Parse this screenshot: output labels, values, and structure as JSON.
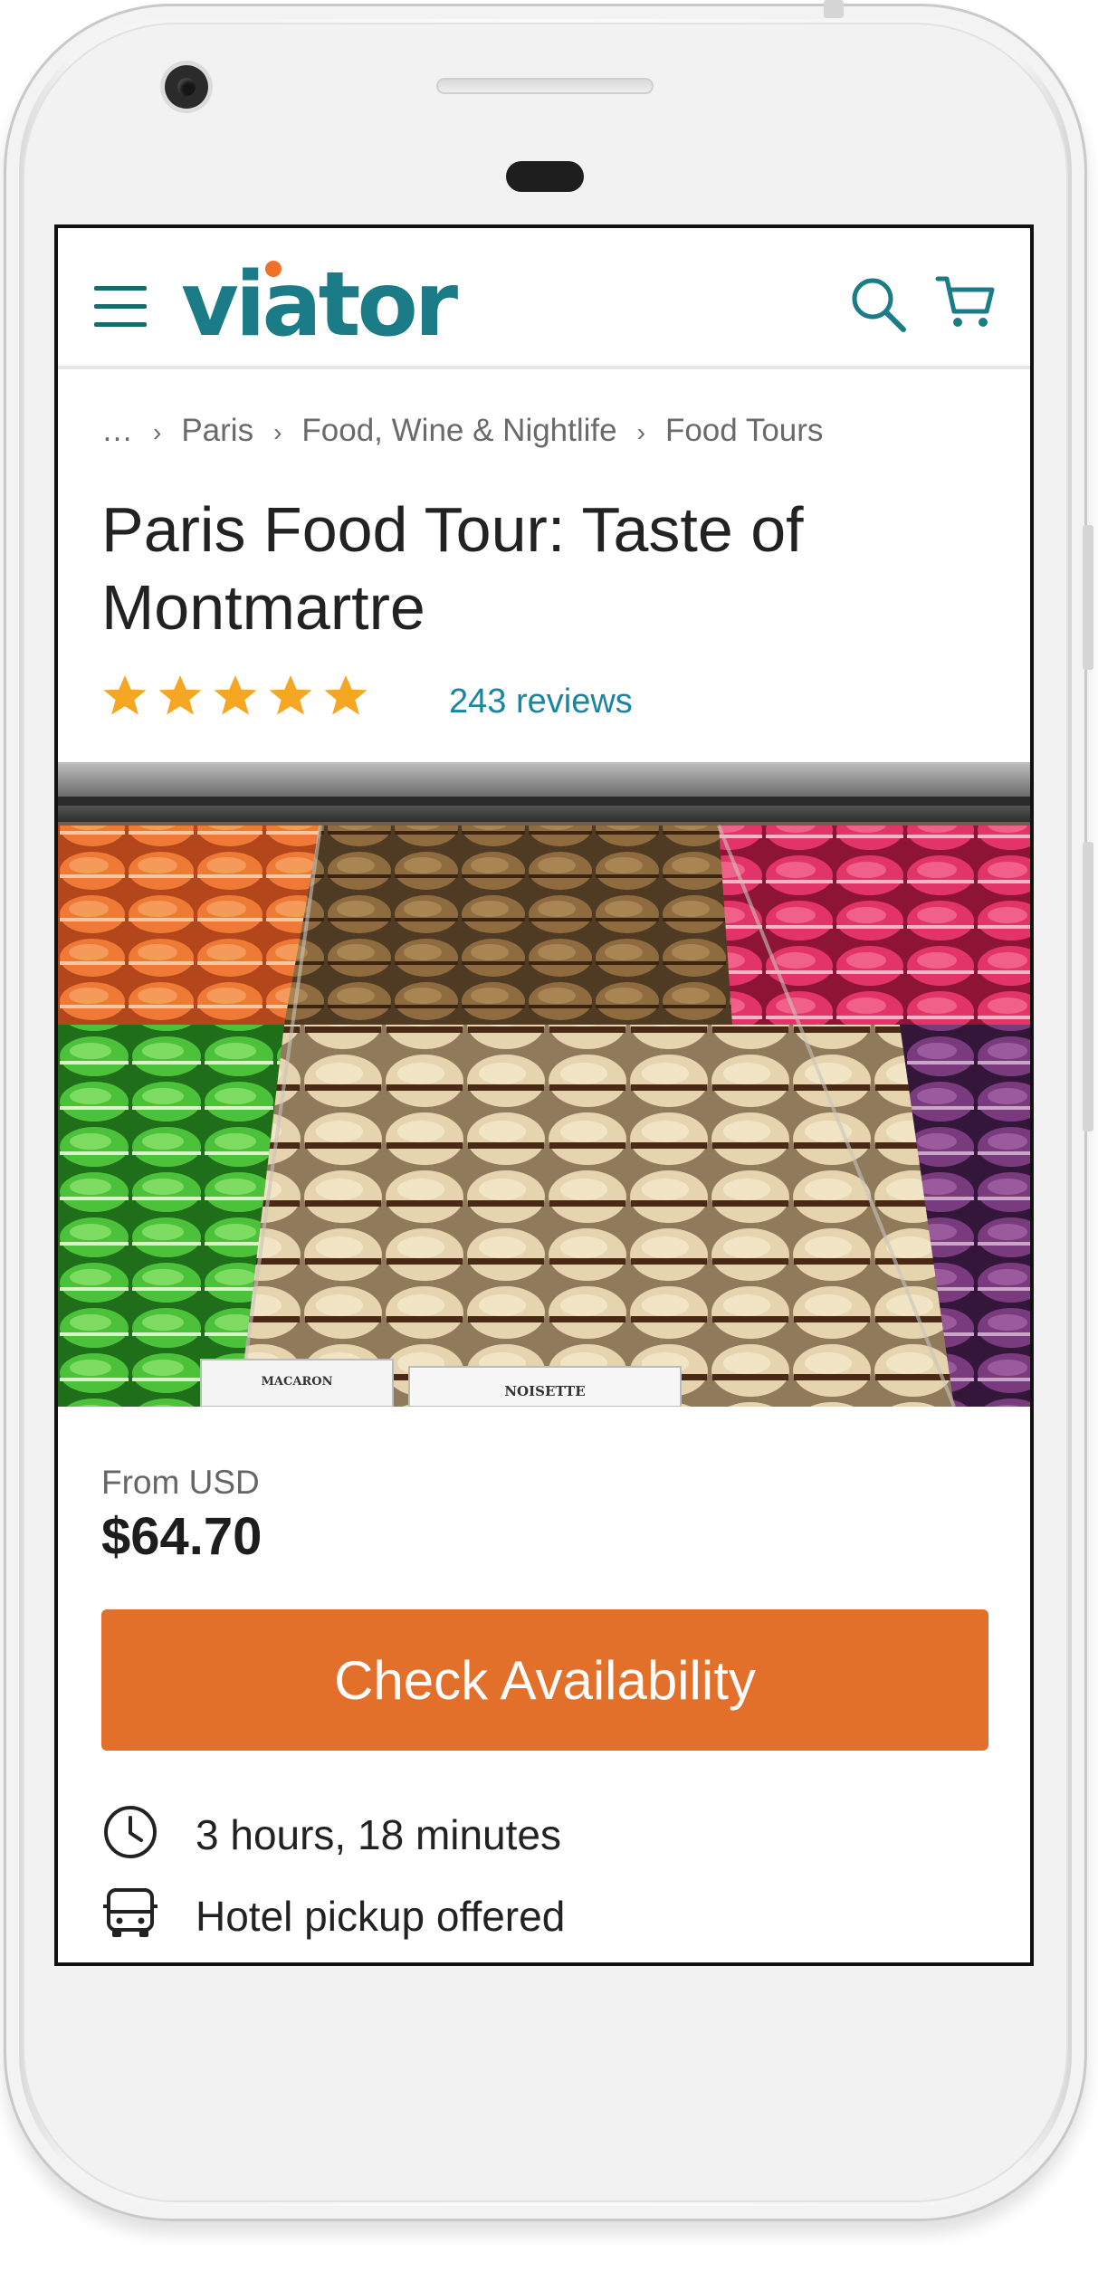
{
  "header": {
    "brand": "viator",
    "menu_icon": "hamburger-menu-icon",
    "search_icon": "search-icon",
    "cart_icon": "shopping-cart-icon",
    "brand_color": "#1b7b86",
    "brand_accent": "#f0712a"
  },
  "breadcrumb": {
    "items": [
      "…",
      "Paris",
      "Food, Wine & Nightlife",
      "Food Tours"
    ],
    "separator": "›"
  },
  "product": {
    "title": "Paris Food Tour: Taste of Montmartre",
    "rating_stars": 5,
    "reviews_text": "243 reviews",
    "star_color": "#f5a623",
    "image_alt": "macarons display photo",
    "price_label": "From USD",
    "price": "$64.70",
    "cta_label": "Check Availability",
    "cta_color": "#e2702a"
  },
  "features": [
    {
      "icon": "clock-icon",
      "text": "3 hours, 18 minutes"
    },
    {
      "icon": "bus-icon",
      "text": "Hotel pickup offered"
    }
  ],
  "photo_labels": {
    "label_left": "MACARON",
    "label_right": "NOISETTE"
  }
}
